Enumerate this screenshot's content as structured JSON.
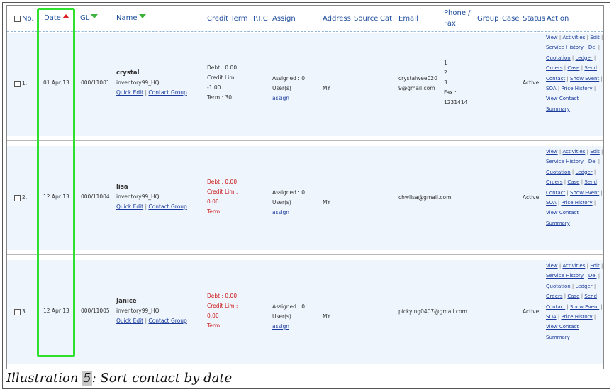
{
  "header": {
    "no": "No.",
    "date": "Date",
    "gl": "GL",
    "name": "Name",
    "credit_term": "Credit Term",
    "pic": "P.I.C",
    "assign": "Assign",
    "address": "Address",
    "source": "Source",
    "cat": "Cat.",
    "email": "Email",
    "phone_fax_1": "Phone /",
    "phone_fax_2": "Fax",
    "group": "Group",
    "case": "Case",
    "status": "Status",
    "action": "Action"
  },
  "rows": [
    {
      "no": "1.",
      "date": "01 Apr 13",
      "gl": "000/11001",
      "name": "crystal",
      "company": "inventory99_HQ",
      "quick_edit": "Quick Edit",
      "contact_group": "Contact Group",
      "debt": "Debt : 0.00",
      "credit_lim": "Credit Lim :",
      "credit_lim_val": "-1.00",
      "term": "Term : 30",
      "assigned": "Assigned : 0",
      "users": "User(s)",
      "assign_link": "assign",
      "address": "MY",
      "email_1": "crystalwee020",
      "email_2": "9@gmail.com",
      "phone_1": "1",
      "phone_2": "2",
      "phone_3": "3",
      "fax_label": "Fax :",
      "fax": "1231414",
      "status": "Active"
    },
    {
      "no": "2.",
      "date": "12 Apr 13",
      "gl": "000/11004",
      "name": "lisa",
      "company": "inventory99_HQ",
      "quick_edit": "Quick Edit",
      "contact_group": "Contact Group",
      "debt": "Debt : 0.00",
      "credit_lim": "Credit Lim :",
      "credit_lim_val": "0.00",
      "term": "Term :",
      "assigned": "Assigned : 0",
      "users": "User(s)",
      "assign_link": "assign",
      "address": "MY",
      "email": "chwlisa@gmail.com",
      "status": "Active"
    },
    {
      "no": "3.",
      "date": "12 Apr 13",
      "gl": "000/11005",
      "name": "Janice",
      "company": "inventory99_HQ",
      "quick_edit": "Quick Edit",
      "contact_group": "Contact Group",
      "debt": "Debt : 0.00",
      "credit_lim": "Credit Lim :",
      "credit_lim_val": "0.00",
      "term": "Term :",
      "assigned": "Assigned : 0",
      "users": "User(s)",
      "assign_link": "assign",
      "address": "MY",
      "email": "pickying0407@gmail.com",
      "status": "Active"
    }
  ],
  "actions": {
    "view": "View",
    "activities": "Activities",
    "edit": "Edit",
    "service": "Service",
    "history": "History",
    "del": "Del",
    "quotation": "Quotation",
    "ledger": "Ledger",
    "orders": "Orders",
    "case": "Case",
    "send_contact": "Send Contact",
    "show_event": "Show Event",
    "soa": "SOA",
    "price_history": "Price History",
    "view_contact": "View Contact",
    "summary": "Summary"
  },
  "caption": {
    "prefix": "Illustration ",
    "number": "5",
    "text": ": Sort contact by date"
  },
  "colors": {
    "highlight": "#2fe02f",
    "header_text": "#1f4e9c",
    "link": "#1a3a9c",
    "warn_text": "#cc1a1a",
    "row_bg": "#eef5fc"
  }
}
